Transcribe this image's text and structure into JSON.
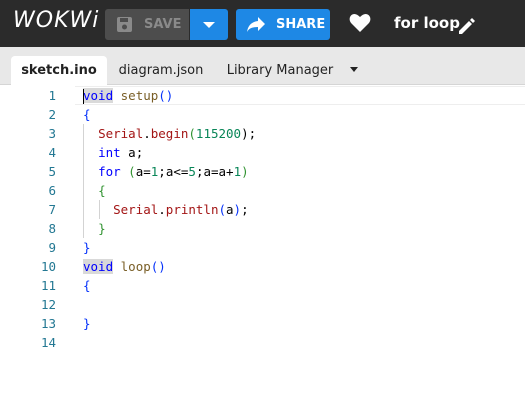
{
  "app": {
    "logo": "WOKWi",
    "project_title": "for loop"
  },
  "toolbar": {
    "save_label": "SAVE",
    "share_label": "SHARE"
  },
  "tabs": [
    {
      "label": "sketch.ino",
      "active": true
    },
    {
      "label": "diagram.json",
      "active": false
    },
    {
      "label": "Library Manager",
      "active": false
    }
  ],
  "editor": {
    "line_numbers": [
      "1",
      "2",
      "3",
      "4",
      "5",
      "6",
      "7",
      "8",
      "9",
      "10",
      "11",
      "12",
      "13",
      "14"
    ],
    "lines": [
      [
        {
          "t": "void",
          "c": "kw sel"
        },
        {
          "t": " ",
          "c": ""
        },
        {
          "t": "setup",
          "c": "fn2"
        },
        {
          "t": "()",
          "c": "br1"
        }
      ],
      [
        {
          "t": "{",
          "c": "br1"
        }
      ],
      [
        {
          "t": "  ",
          "c": ""
        },
        {
          "t": "Serial",
          "c": "fn"
        },
        {
          "t": ".",
          "c": "pnc"
        },
        {
          "t": "begin",
          "c": "fn"
        },
        {
          "t": "(",
          "c": "br2"
        },
        {
          "t": "115200",
          "c": "num"
        },
        {
          "t": ");",
          "c": "pnc"
        }
      ],
      [
        {
          "t": "  ",
          "c": ""
        },
        {
          "t": "int",
          "c": "kw"
        },
        {
          "t": " a;",
          "c": "pnc"
        }
      ],
      [
        {
          "t": "  ",
          "c": ""
        },
        {
          "t": "for",
          "c": "kw"
        },
        {
          "t": " ",
          "c": ""
        },
        {
          "t": "(",
          "c": "br2"
        },
        {
          "t": "a=",
          "c": "pnc"
        },
        {
          "t": "1",
          "c": "num"
        },
        {
          "t": ";a<=",
          "c": "pnc"
        },
        {
          "t": "5",
          "c": "num"
        },
        {
          "t": ";a=a+",
          "c": "pnc"
        },
        {
          "t": "1",
          "c": "num"
        },
        {
          "t": ")",
          "c": "br2"
        }
      ],
      [
        {
          "t": "  ",
          "c": ""
        },
        {
          "t": "{",
          "c": "br2"
        }
      ],
      [
        {
          "t": "    ",
          "c": ""
        },
        {
          "t": "Serial",
          "c": "fn"
        },
        {
          "t": ".",
          "c": "pnc"
        },
        {
          "t": "println",
          "c": "fn"
        },
        {
          "t": "(",
          "c": "br1"
        },
        {
          "t": "a",
          "c": "pnc"
        },
        {
          "t": ")",
          "c": "br1"
        },
        {
          "t": ";",
          "c": "pnc"
        }
      ],
      [
        {
          "t": "  ",
          "c": ""
        },
        {
          "t": "}",
          "c": "br2"
        }
      ],
      [
        {
          "t": "}",
          "c": "br1"
        }
      ],
      [
        {
          "t": "void",
          "c": "kw sel"
        },
        {
          "t": " ",
          "c": ""
        },
        {
          "t": "loop",
          "c": "fn2"
        },
        {
          "t": "()",
          "c": "br1"
        }
      ],
      [
        {
          "t": "{",
          "c": "br1"
        }
      ],
      [],
      [
        {
          "t": "}",
          "c": "br1"
        }
      ],
      []
    ]
  }
}
